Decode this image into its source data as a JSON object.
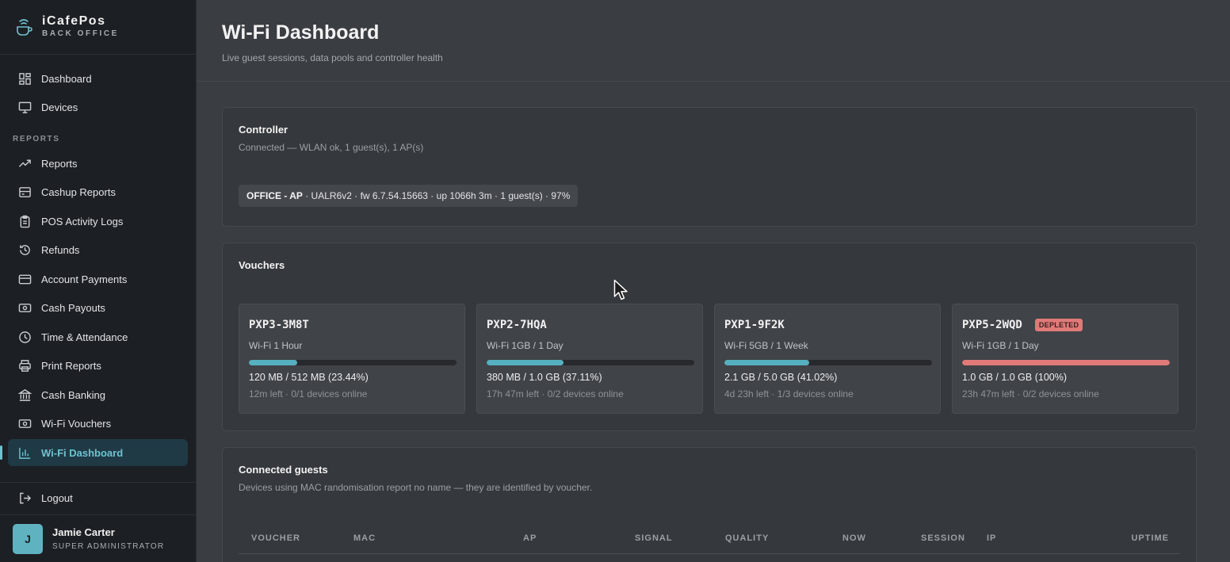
{
  "brand": {
    "name": "iCafePos",
    "subtitle": "BACK OFFICE",
    "accent_color": "#6fc2d0"
  },
  "sidebar": {
    "top_items": [
      {
        "label": "Dashboard",
        "icon": "grid-icon"
      },
      {
        "label": "Devices",
        "icon": "monitor-icon"
      }
    ],
    "section_label": "REPORTS",
    "items": [
      {
        "label": "Reports",
        "icon": "trend-icon"
      },
      {
        "label": "Cashup Reports",
        "icon": "register-icon"
      },
      {
        "label": "POS Activity Logs",
        "icon": "clipboard-icon"
      },
      {
        "label": "Refunds",
        "icon": "history-icon"
      },
      {
        "label": "Account Payments",
        "icon": "card-icon"
      },
      {
        "label": "Cash Payouts",
        "icon": "cash-icon"
      },
      {
        "label": "Time & Attendance",
        "icon": "clock-icon"
      },
      {
        "label": "Print Reports",
        "icon": "printer-icon"
      },
      {
        "label": "Cash Banking",
        "icon": "bank-icon"
      },
      {
        "label": "Wi-Fi Vouchers",
        "icon": "ticket-icon"
      },
      {
        "label": "Wi-Fi Dashboard",
        "icon": "chart-icon",
        "active": true
      }
    ],
    "logout_label": "Logout",
    "user": {
      "initial": "J",
      "name": "Jamie Carter",
      "role": "SUPER ADMINISTRATOR"
    }
  },
  "header": {
    "title": "Wi-Fi Dashboard",
    "subtitle": "Live guest sessions, data pools and controller health"
  },
  "controller": {
    "title": "Controller",
    "status": "Connected — WLAN ok, 1 guest(s), 1 AP(s)",
    "ap_name": "OFFICE - AP",
    "ap_details": " · UALR6v2 · fw 6.7.54.15663 · up 1066h 3m · 1 guest(s) · 97%"
  },
  "vouchers": {
    "title": "Vouchers",
    "items": [
      {
        "code": "PXP3-3M8T",
        "plan": "Wi-Fi 1 Hour",
        "usage": "120 MB / 512 MB (23.44%)",
        "fraction": 0.2344,
        "meta": "12m left · 0/1 devices online",
        "badge": ""
      },
      {
        "code": "PXP2-7HQA",
        "plan": "Wi-Fi 1GB / 1 Day",
        "usage": "380 MB / 1.0 GB (37.11%)",
        "fraction": 0.3711,
        "meta": "17h 47m left · 0/2 devices online",
        "badge": ""
      },
      {
        "code": "PXP1-9F2K",
        "plan": "Wi-Fi 5GB / 1 Week",
        "usage": "2.1 GB / 5.0 GB (41.02%)",
        "fraction": 0.4102,
        "meta": "4d 23h left · 1/3 devices online",
        "badge": ""
      },
      {
        "code": "PXP5-2WQD",
        "plan": "Wi-Fi 1GB / 1 Day",
        "usage": "1.0 GB / 1.0 GB (100%)",
        "fraction": 1.0,
        "meta": "23h 47m left · 0/2 devices online",
        "badge": "DEPLETED"
      }
    ]
  },
  "guests": {
    "title": "Connected guests",
    "subtitle": "Devices using MAC randomisation report no name — they are identified by voucher.",
    "columns": [
      "VOUCHER",
      "MAC",
      "AP",
      "SIGNAL",
      "QUALITY",
      "NOW",
      "SESSION",
      "IP",
      "UPTIME"
    ]
  }
}
